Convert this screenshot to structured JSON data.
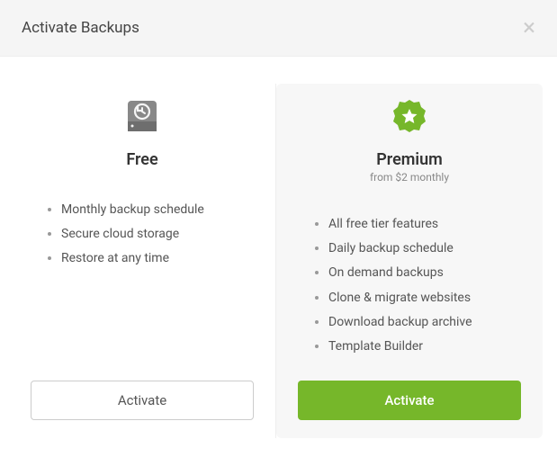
{
  "header": {
    "title": "Activate Backups"
  },
  "plans": {
    "free": {
      "title": "Free",
      "features": [
        "Monthly backup schedule",
        "Secure cloud storage",
        "Restore at any time"
      ],
      "button": "Activate"
    },
    "premium": {
      "title": "Premium",
      "subtitle": "from $2 monthly",
      "features": [
        "All free tier features",
        "Daily backup schedule",
        "On demand backups",
        "Clone & migrate websites",
        "Download backup archive",
        "Template Builder"
      ],
      "button": "Activate"
    }
  }
}
